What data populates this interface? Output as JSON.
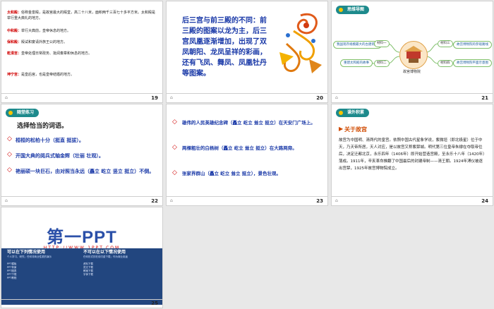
{
  "slides": [
    {
      "number": "19",
      "rows": [
        {
          "term": "太和殿：",
          "text": "俗称金銮殿，是故宫最大的殿堂，高二十八米，面积两千三百七十多平方米。太和殿是举行重大典礼的地方。"
        },
        {
          "term": "中和殿：",
          "text": "举行大典前，皇帝休息的地方。"
        },
        {
          "term": "保和殿：",
          "text": "殿试和宴请外族王公的地方。"
        },
        {
          "term": "乾清宫：",
          "text": "皇帝处理日常政务、批阅奏章和休息的地方。"
        },
        {
          "term": "坤宁宫：",
          "text": "是皇后宫，也是皇帝结婚的地方。"
        }
      ]
    },
    {
      "number": "20",
      "poem": "后三宫与前三殿的不同：前三殿的图案以龙为主，后三宫凤凰逐渐增加，出现了双凤朝阳、龙凤呈祥的彩画，还有飞凤、舞凤、凤凰牡丹等图案。"
    },
    {
      "number": "21",
      "header": "思维导图",
      "center": "故宫博物院",
      "left_boxes": [
        "材料一",
        "材料二"
      ],
      "right_boxes": [
        "材料三",
        "材料四"
      ],
      "left_leaves": [
        "我国现存规模最大的古建筑群",
        "重建太和殿的故事"
      ],
      "right_leaves": [
        "故宫博物院的参观路线",
        "故宫博物院平面示意图"
      ]
    },
    {
      "number": "22",
      "header": "随堂练习",
      "title": "选择恰当的词语。",
      "items": [
        "桓桓的松柏十分（挺直 挺拔）。",
        "开国大典的阅兵式轴金辉（壮丽 壮观）。",
        "艳丽硕一块巨石，由对照当永远（矗立 屹立 竖立 挺立）不倒。"
      ]
    },
    {
      "number": "23",
      "items": [
        "雄伟的人民英雄纪念碑（矗立 屹立 耸立 挺立）在天安门广场上。",
        "两棵粗壮的白杨树（矗立 屹立 耸立 挺立）在大路两旁。",
        "张家界群山（矗立 屹立 耸立 挺立），景色壮观。"
      ]
    },
    {
      "number": "24",
      "header": "课外积累",
      "subtitle": "关于故宫",
      "body": "故宫为中国明、清两代的皇宫。依照中国古代星象学说，紫微垣（即北极星）位于中天，乃天帝所居，天人对应，是以故宫又称紫禁城。明代第三位皇帝朱棣在夺取帝位后，决定迁都北京，永乐四年（1406年）即开始营造宫殿，至永乐十八年（1420年）落成。1911年，辛亥革命推翻了中国最后的封建帝制——清王朝。1924年溥仪被逐出宫禁，1925年故宫博物院成立。"
    },
    {
      "number": "25",
      "logo": "第一PPT",
      "url": "HTTP://WWW.1PPT.COM",
      "col_left_title": "可以在下列情况使用",
      "col_right_title": "不可以在以下情况使用",
      "col_left_sub": "个人学习、研究；任何非商业性质的演示",
      "col_right_sub": "任何形式的在线付费下载；作为商业用途",
      "links": [
        "PPT模板",
        "PPT背景",
        "PPT图表",
        "PPT下载",
        "PPT教程",
        "资料下载",
        "范文下载",
        "教案下载",
        "字体下载"
      ]
    }
  ]
}
